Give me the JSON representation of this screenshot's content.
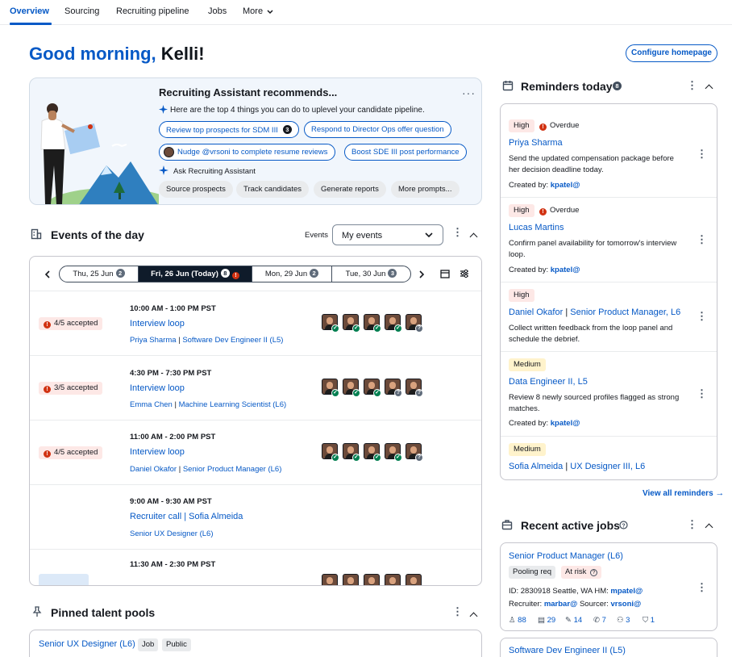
{
  "nav": {
    "tabs": [
      "Overview",
      "Sourcing",
      "Recruiting pipeline",
      "Jobs",
      "More"
    ]
  },
  "greeting": {
    "prefix": "Good morning,",
    "name": "Kelli!"
  },
  "configure_label": "Configure homepage",
  "assistant": {
    "title": "Recruiting Assistant recommends...",
    "subtitle": "Here are the top 4 things you can do to uplevel your candidate pipeline.",
    "recommendations": [
      {
        "label": "Review top prospects for SDM III",
        "badge": "3"
      },
      {
        "label": "Respond to Director Ops offer question"
      },
      {
        "label": "Nudge @vrsoni to complete resume reviews"
      },
      {
        "label": "Boost SDE III post performance"
      }
    ],
    "ask_label": "Ask Recruiting Assistant",
    "quick_actions": [
      "Source prospects",
      "Track candidates",
      "Generate reports",
      "More prompts..."
    ]
  },
  "events": {
    "title": "Events of the day",
    "filter_label": "Events",
    "filter_value": "My events",
    "dates": [
      {
        "label": "Thu, 25 Jun",
        "count": "2"
      },
      {
        "label": "Fri, 26 Jun (Today)",
        "count": "8"
      },
      {
        "label": "Mon, 29 Jun",
        "count": "2"
      },
      {
        "label": "Tue, 30 Jun",
        "count": "3"
      }
    ],
    "items": [
      {
        "status": "4/5 accepted",
        "time": "10:00 AM - 1:00 PM PST",
        "title": "Interview loop",
        "person": "Priya Sharma",
        "role": "Software Dev Engineer II (L5)",
        "marks": [
          "ok",
          "ok",
          "ok",
          "ok",
          "q"
        ]
      },
      {
        "status": "3/5 accepted",
        "time": "4:30 PM - 7:30 PM PST",
        "title": "Interview loop",
        "person": "Emma Chen",
        "role": "Machine Learning Scientist (L6)",
        "marks": [
          "ok",
          "ok",
          "ok",
          "q",
          "q"
        ]
      },
      {
        "status": "4/5 accepted",
        "time": "11:00 AM - 2:00 PM PST",
        "title": "Interview loop",
        "person": "Daniel Okafor",
        "role": "Senior Product Manager (L6)",
        "marks": [
          "ok",
          "ok",
          "ok",
          "ok",
          "q"
        ]
      },
      {
        "status": "",
        "time": "9:00 AM - 9:30 AM PST",
        "title": "Recruiter call | Sofia Almeida",
        "person": "",
        "role": "Senior UX Designer (L6)",
        "marks": []
      },
      {
        "status": "",
        "time": "11:30 AM - 2:30 PM PST",
        "title": "",
        "person": "",
        "role": "",
        "marks": []
      }
    ]
  },
  "pinned": {
    "title": "Pinned talent pools",
    "first": {
      "name": "Senior UX Designer (L6)",
      "tags": [
        "Job",
        "Public"
      ]
    }
  },
  "reminders": {
    "title": "Reminders today",
    "count": "8",
    "overdue_label": "Overdue",
    "created_label": "Created by:",
    "items": [
      {
        "priority": "High",
        "overdue": true,
        "title": "Priya Sharma",
        "title2": "",
        "desc": "Send the updated compensation package before her decision deadline today.",
        "creator": "kpatel@"
      },
      {
        "priority": "High",
        "overdue": true,
        "title": "Lucas Martins",
        "title2": "",
        "desc": "Confirm panel availability for tomorrow's interview loop.",
        "creator": "kpatel@"
      },
      {
        "priority": "High",
        "overdue": false,
        "title": "Daniel Okafor",
        "title2": "Senior Product Manager, L6",
        "desc": "Collect written feedback from the loop panel and schedule the debrief.",
        "creator": ""
      },
      {
        "priority": "Medium",
        "overdue": false,
        "title": "Data Engineer II, L5",
        "title2": "",
        "desc": "Review 8 newly sourced profiles flagged as strong matches.",
        "creator": "kpatel@"
      },
      {
        "priority": "Medium",
        "overdue": false,
        "title": "Sofia Almeida",
        "title2": "UX Designer III, L6",
        "desc": "",
        "creator": ""
      }
    ],
    "view_all": "View all reminders"
  },
  "jobs": {
    "title": "Recent active jobs",
    "first": {
      "title": "Senior Product Manager (L6)",
      "tags": [
        "Pooling req",
        "At risk"
      ],
      "id_line": "ID: 2830918",
      "location": "Seattle, WA",
      "hm_label": "HM:",
      "hm": "mpatel@",
      "recruiter_label": "Recruiter:",
      "recruiter": "marbar@",
      "sourcer_label": "Sourcer:",
      "sourcer": "vrsoni@",
      "stats": [
        "88",
        "29",
        "14",
        "7",
        "3",
        "1"
      ]
    },
    "second_title": "Software Dev Engineer II (L5)"
  },
  "colors": {
    "accent": "#0659c6",
    "error": "#d13212",
    "success": "#037f51",
    "selected_date": "#0f1b2a"
  }
}
